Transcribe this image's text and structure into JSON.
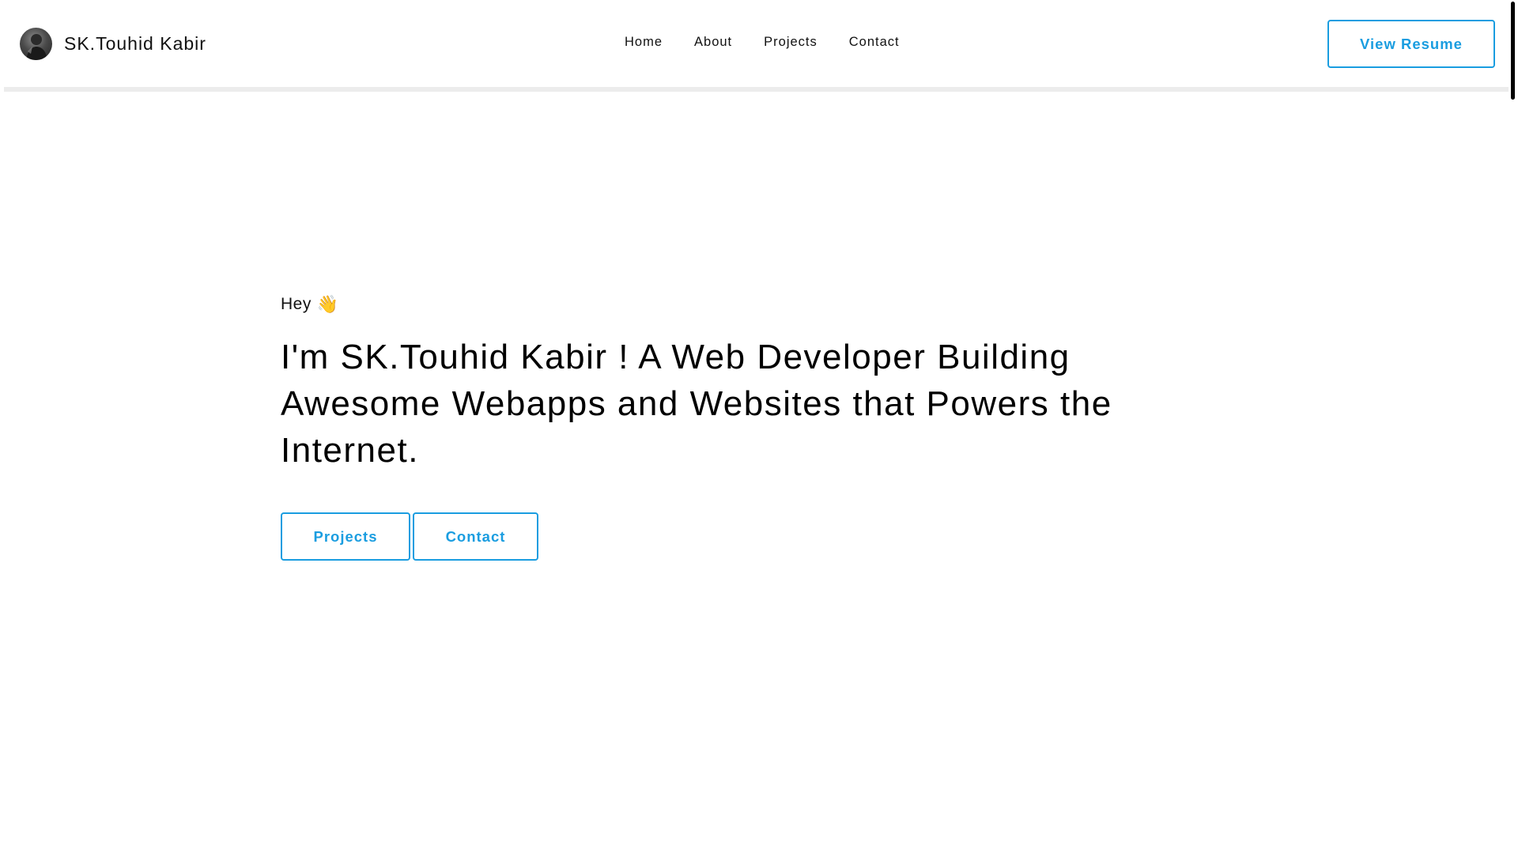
{
  "header": {
    "brand_name": "SK.Touhid Kabir",
    "nav": [
      {
        "label": "Home"
      },
      {
        "label": "About"
      },
      {
        "label": "Projects"
      },
      {
        "label": "Contact"
      }
    ],
    "resume_label": "View Resume"
  },
  "hero": {
    "greeting": "Hey",
    "wave": "👋",
    "headline": "I'm SK.Touhid Kabir ! A Web Developer Building Awesome Webapps and Websites that Powers the Internet.",
    "buttons": {
      "projects_label": "Projects",
      "contact_label": "Contact"
    }
  },
  "colors": {
    "accent": "#1a9de0",
    "text": "#000000",
    "header_border": "#ececec"
  },
  "icons": {
    "avatar": "profile-photo",
    "wave": "waving-hand-icon"
  }
}
